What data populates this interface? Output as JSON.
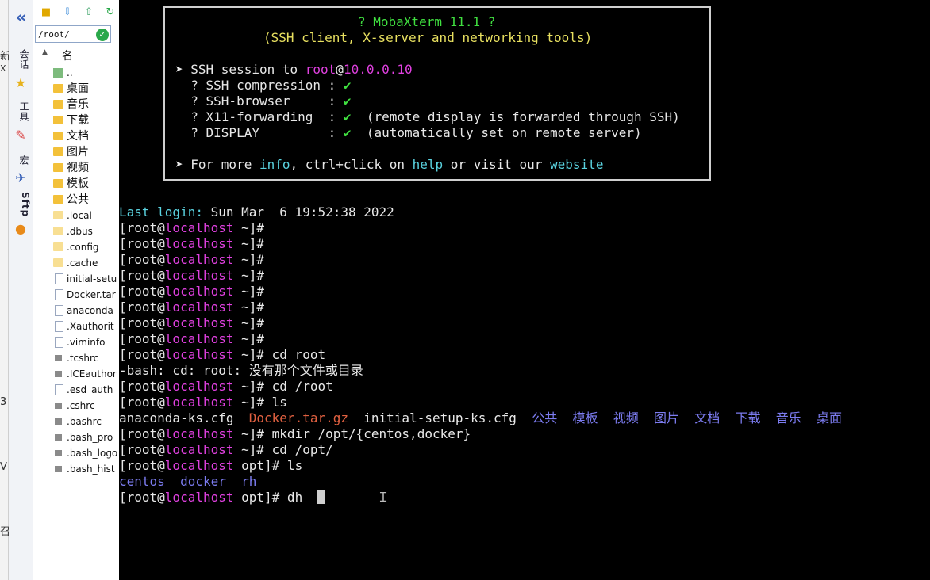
{
  "edge": {
    "chars": [
      "新",
      "X",
      "3",
      "V",
      "召"
    ]
  },
  "sidetabs": {
    "collapse_glyph": "«",
    "tabs": [
      {
        "label": "会话"
      },
      {
        "label": "工具"
      },
      {
        "label": "宏"
      },
      {
        "label": "Sftp"
      }
    ]
  },
  "sftp": {
    "path": "/root/",
    "column_header": "名",
    "files": [
      {
        "name": "..",
        "type": "up"
      },
      {
        "name": "桌面",
        "type": "folder"
      },
      {
        "name": "音乐",
        "type": "folder"
      },
      {
        "name": "下载",
        "type": "folder"
      },
      {
        "name": "文档",
        "type": "folder"
      },
      {
        "name": "图片",
        "type": "folder"
      },
      {
        "name": "视频",
        "type": "folder"
      },
      {
        "name": "模板",
        "type": "folder"
      },
      {
        "name": "公共",
        "type": "folder"
      },
      {
        "name": ".local",
        "type": "hidden-folder"
      },
      {
        "name": ".dbus",
        "type": "hidden-folder"
      },
      {
        "name": ".config",
        "type": "hidden-folder"
      },
      {
        "name": ".cache",
        "type": "hidden-folder"
      },
      {
        "name": "initial-setu",
        "type": "file"
      },
      {
        "name": "Docker.tar",
        "type": "file"
      },
      {
        "name": "anaconda-",
        "type": "file"
      },
      {
        "name": ".Xauthorit",
        "type": "file"
      },
      {
        "name": ".viminfo",
        "type": "file"
      },
      {
        "name": ".tcshrc",
        "type": "gray"
      },
      {
        "name": ".ICEauthor",
        "type": "gray"
      },
      {
        "name": ".esd_auth",
        "type": "file"
      },
      {
        "name": ".cshrc",
        "type": "gray"
      },
      {
        "name": ".bashrc",
        "type": "gray"
      },
      {
        "name": ".bash_pro",
        "type": "gray"
      },
      {
        "name": ".bash_logo",
        "type": "gray"
      },
      {
        "name": ".bash_hist",
        "type": "gray"
      }
    ]
  },
  "banner": {
    "title": "? MobaXterm 11.1 ?",
    "subtitle": "(SSH client, X-server and networking tools)",
    "session_prefix": "➤ SSH session to ",
    "session_user": "root",
    "session_at": "@",
    "session_host": "10.0.0.10",
    "features": [
      {
        "label": "  ? SSH compression : ",
        "check": "✔",
        "note": ""
      },
      {
        "label": "  ? SSH-browser     : ",
        "check": "✔",
        "note": ""
      },
      {
        "label": "  ? X11-forwarding  : ",
        "check": "✔",
        "note": "  (remote display is forwarded through SSH)"
      },
      {
        "label": "  ? DISPLAY         : ",
        "check": "✔",
        "note": "  (automatically set on remote server)"
      }
    ],
    "more_prefix": "➤ For more ",
    "more_info": "info",
    "more_mid": ", ctrl+click on ",
    "more_help": "help",
    "more_mid2": " or visit our ",
    "more_website": "website"
  },
  "terminal": {
    "last_login_label": "Last login:",
    "last_login_value": " Sun Mar  6 19:52:38 2022",
    "prompt": {
      "open": "[root@",
      "host": "localhost",
      "home_dir": " ~]#",
      "opt_dir": " opt]#"
    },
    "cmd_cd_root": " cd root",
    "error_line": "-bash: cd: root: 没有那个文件或目录",
    "cmd_cd_slash_root": " cd /root",
    "cmd_ls": " ls",
    "ls_root": {
      "plain1": "anaconda-ks.cfg  ",
      "archive": "Docker.tar.gz",
      "plain2": "  initial-setup-ks.cfg  ",
      "dirs": "公共  模板  视频  图片  文档  下载  音乐  桌面"
    },
    "cmd_mkdir": " mkdir /opt/{centos,docker}",
    "cmd_cd_opt": " cd /opt/",
    "ls_opt": "centos  docker  rh",
    "cmd_current": " dh "
  }
}
